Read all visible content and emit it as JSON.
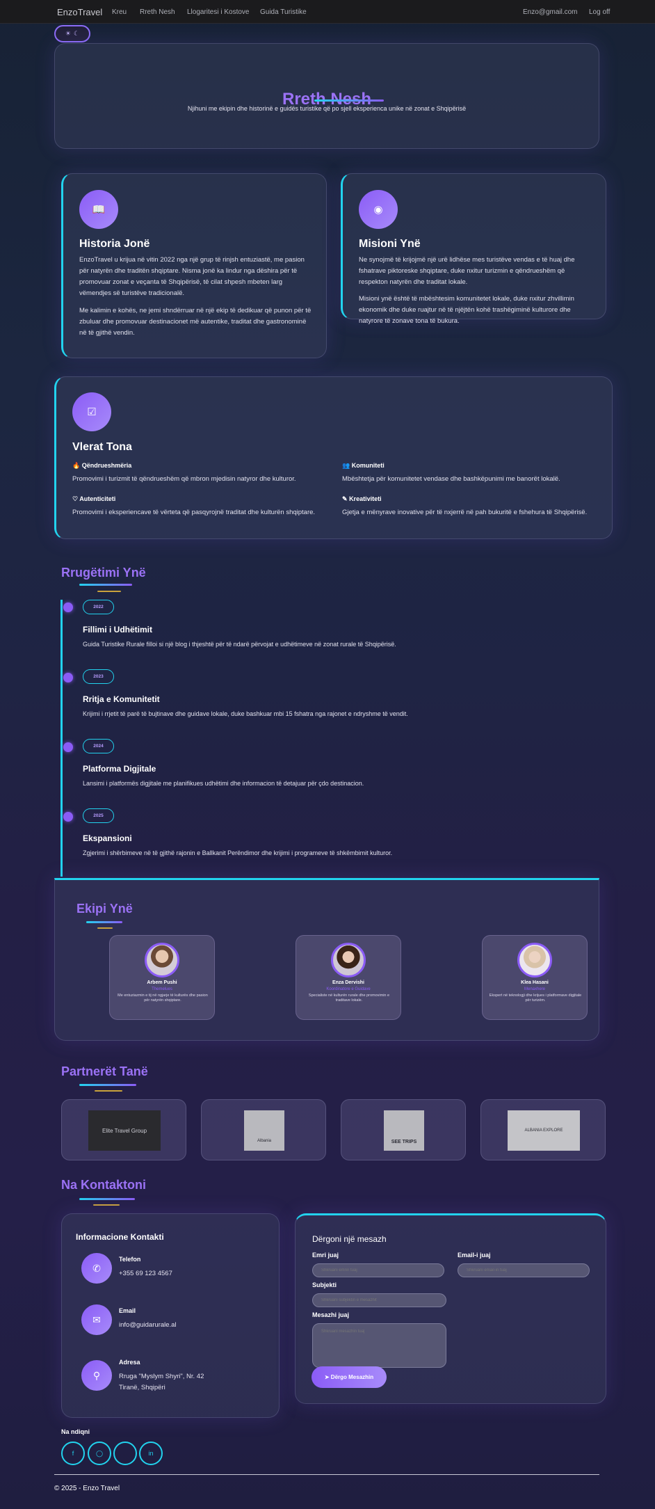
{
  "nav": {
    "brand": "EnzoTravel",
    "links": [
      "Kreu",
      "Rreth Nesh",
      "Llogaritesi i Kostove",
      "Guida Turistike"
    ],
    "email": "Enzo@gmail.com",
    "logout": "Log off"
  },
  "theme_toggle": {
    "sun": "☀",
    "moon": "☾"
  },
  "hero": {
    "title": "Rreth Nesh",
    "subtitle": "Njihuni me ekipin dhe historinë e guidës turistike që po sjell eksperienca unike në zonat e Shqipërisë"
  },
  "history": {
    "title": "Historia Jonë",
    "p1": "EnzoTravel u krijua në vitin 2022 nga një grup të rinjsh entuziastë, me pasion për natyrën dhe traditën shqiptare. Nisma jonë ka lindur nga dëshira për të promovuar zonat e veçanta të Shqipërisë, të cilat shpesh mbeten larg vëmendjes së turistëve tradicionalë.",
    "p2": "Me kalimin e kohës, ne jemi shndërruar në një ekip të dedikuar që punon për të zbuluar dhe promovuar destinacionet më autentike, traditat dhe gastronominë në të gjithë vendin."
  },
  "mission": {
    "title": "Misioni Ynë",
    "p1": "Ne synojmë të krijojmë një urë lidhëse mes turistëve vendas e të huaj dhe fshatrave piktoreske shqiptare, duke nxitur turizmin e qëndrueshëm që respekton natyrën dhe traditat lokale.",
    "p2": "Misioni ynë është të mbështesim komunitetet lokale, duke nxitur zhvillimin ekonomik dhe duke ruajtur në të njëjtën kohë trashëgiminë kulturore dhe natyrore të zonave tona të bukura."
  },
  "values": {
    "title": "Vlerat Tona",
    "items": [
      {
        "icon": "🔥",
        "label": "Qëndrueshmëria",
        "text": "Promovimi i turizmit të qëndrueshëm që mbron mjedisin natyror dhe kulturor."
      },
      {
        "icon": "👥",
        "label": "Komuniteti",
        "text": "Mbështetja për komunitetet vendase dhe bashkëpunimi me banorët lokalë."
      },
      {
        "icon": "♡",
        "label": "Autenticiteti",
        "text": "Promovimi i eksperiencave të vërteta që pasqyrojnë traditat dhe kulturën shqiptare."
      },
      {
        "icon": "✎",
        "label": "Kreativiteti",
        "text": "Gjetja e mënyrave inovative për të nxjerrë në pah bukuritë e fshehura të Shqipërisë."
      }
    ]
  },
  "journey": {
    "title": "Rrugëtimi Ynë",
    "items": [
      {
        "year": "2022",
        "title": "Fillimi i Udhëtimit",
        "desc": "Guida Turistike Rurale filloi si një blog i thjeshtë për të ndarë përvojat e udhëtimeve në zonat rurale të Shqipërisë."
      },
      {
        "year": "2023",
        "title": "Rritja e Komunitetit",
        "desc": "Krijimi i rrjetit të parë të bujtinave dhe guidave lokale, duke bashkuar mbi 15 fshatra nga rajonet e ndryshme të vendit."
      },
      {
        "year": "2024",
        "title": "Platforma Digjitale",
        "desc": "Lansimi i platformës digjitale me planifikues udhëtimi dhe informacion të detajuar për çdo destinacion."
      },
      {
        "year": "2025",
        "title": "Ekspansioni",
        "desc": "Zgjerimi i shërbimeve në të gjithë rajonin e Ballkanit Perëndimor dhe krijimi i programeve të shkëmbimit kulturor."
      }
    ]
  },
  "team": {
    "title": "Ekipi Ynë",
    "members": [
      {
        "name": "Arbem Pushi",
        "role": "Themelues",
        "desc": "Me entuziazmin e tij në ngjarje të kulturës dhe pasion për natyrën shqiptare."
      },
      {
        "name": "Enza Dervishi",
        "role": "Koordinatore e Guidave",
        "desc": "Specialiste në kulturën rurale dhe promovimin e traditave lokale."
      },
      {
        "name": "Klea Hasani",
        "role": "Menaxhere",
        "desc": "Ekspert në teknologji dhe krijues i platformave digjitale për turizëm."
      }
    ]
  },
  "partners": {
    "title": "Partnerët Tanë",
    "logos": [
      "Elite Travel Group",
      "Albania",
      "SEE TRIPS",
      "ALBANIA EXPLORE"
    ]
  },
  "contact": {
    "title": "Na Kontaktoni",
    "info_title": "Informacione Kontakti",
    "phone_label": "Telefon",
    "phone": "+355 69 123 4567",
    "email_label": "Email",
    "email": "info@guidarurale.al",
    "address_label": "Adresa",
    "address1": "Rruga \"Myslym Shyri\", Nr. 42",
    "address2": "Tiranë, Shqipëri",
    "form_title": "Dërgoni një mesazh",
    "name_label": "Emri juaj",
    "name_ph": "Shkruani emrin tuaj",
    "email_field_label": "Email-i juaj",
    "email_ph": "Shkruani email-in tuaj",
    "subject_label": "Subjekti",
    "subject_ph": "Shkruani subjektin e mesazhit",
    "message_label": "Mesazhi juaj",
    "message_ph": "Shkruani mesazhin tuaj",
    "send": "Dërgo Mesazhin"
  },
  "follow": {
    "title": "Na ndiqni"
  },
  "footer": {
    "copyright": "© 2025 - Enzo Travel"
  },
  "colors": {
    "accent": "#8b5cf6",
    "cyan": "#22d3ee",
    "gold": "#c9a23c"
  }
}
